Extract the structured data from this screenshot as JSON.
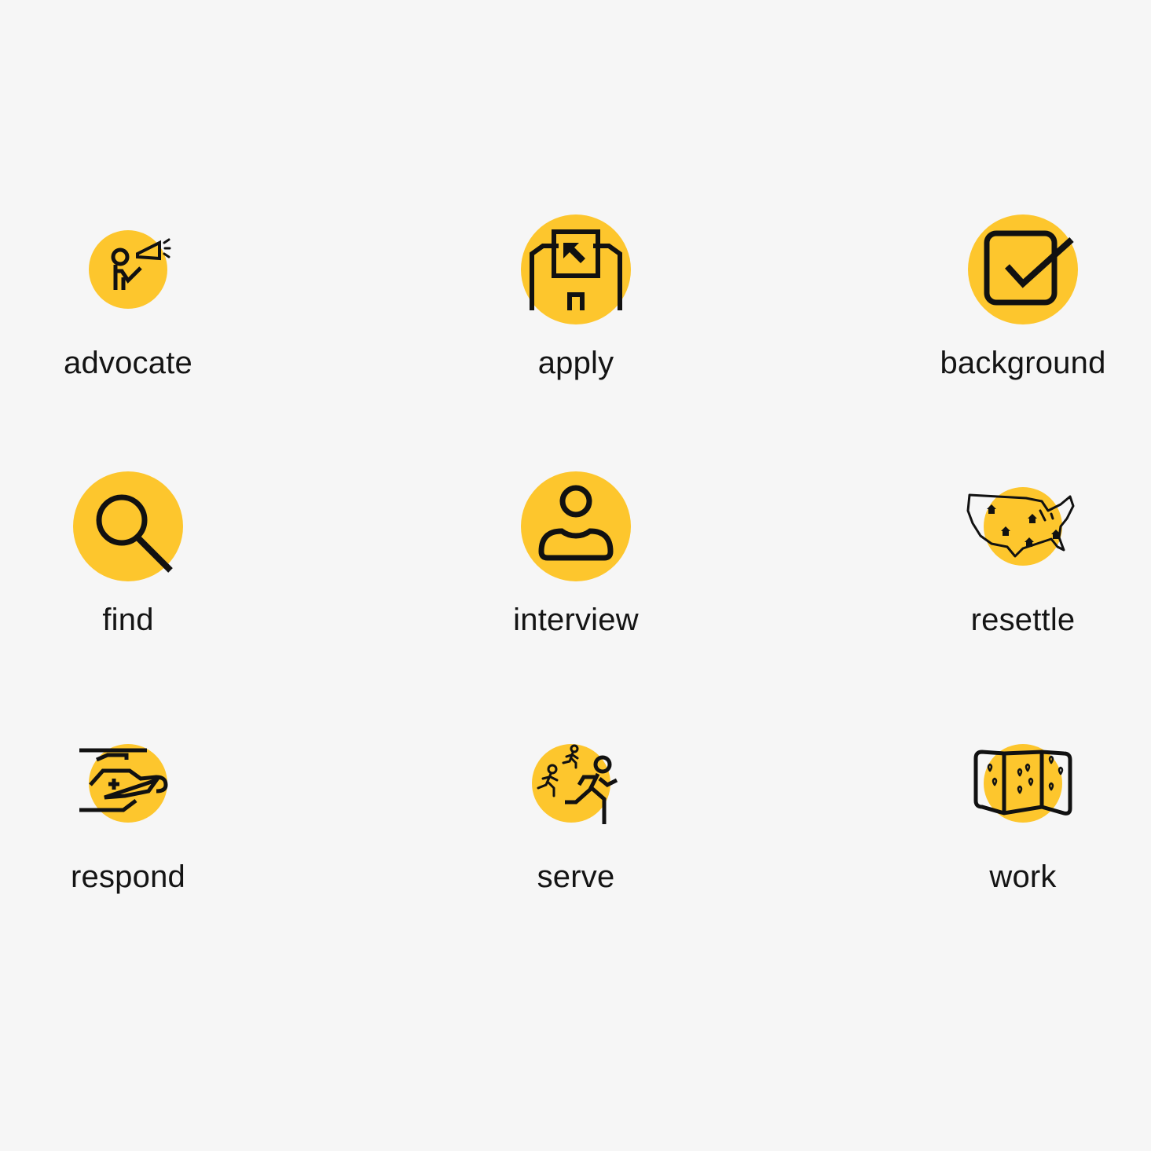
{
  "colors": {
    "background": "#f6f6f6",
    "accent": "#fdc62d",
    "ink": "#111111"
  },
  "icons": [
    {
      "label": "advocate",
      "icon": "megaphone-person-icon"
    },
    {
      "label": "apply",
      "icon": "application-form-icon"
    },
    {
      "label": "background",
      "icon": "checkbox-check-icon"
    },
    {
      "label": "find",
      "icon": "magnifying-glass-icon"
    },
    {
      "label": "interview",
      "icon": "person-icon"
    },
    {
      "label": "resettle",
      "icon": "us-map-homes-icon"
    },
    {
      "label": "respond",
      "icon": "helicopter-medical-icon"
    },
    {
      "label": "serve",
      "icon": "running-people-icon"
    },
    {
      "label": "work",
      "icon": "folded-map-pins-icon"
    }
  ]
}
